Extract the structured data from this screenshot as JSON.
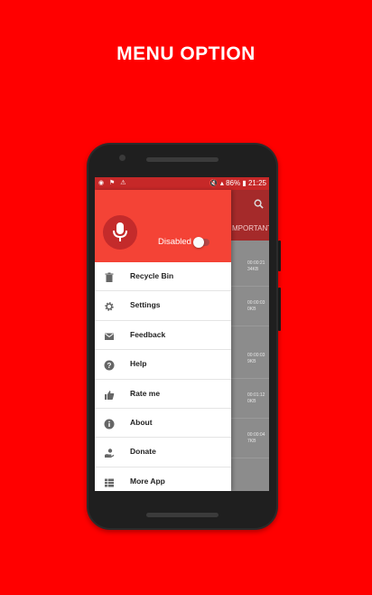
{
  "headline": "MENU OPTION",
  "status_bar": {
    "left_icons": "◉ ⚑ ⚠",
    "right_text": "🔇 ▴ 86% ▮ 21:25"
  },
  "background_app": {
    "tab_label": "MPORTANT",
    "rows": [
      {
        "time": "00:00:21",
        "size": "34KB"
      },
      {
        "time": "00:00:03",
        "size": "0KB"
      },
      {
        "time": "00:00:03",
        "size": "9KB"
      },
      {
        "time": "00:01:12",
        "size": "0KB"
      },
      {
        "time": "00:00:04",
        "size": "7KB"
      }
    ]
  },
  "drawer": {
    "toggle_label": "Disabled",
    "toggle_on": false,
    "accent_color": "#f44336",
    "items": [
      {
        "label": "Recycle Bin",
        "icon": "trash-icon"
      },
      {
        "label": "Settings",
        "icon": "gear-icon"
      },
      {
        "label": "Feedback",
        "icon": "mail-icon"
      },
      {
        "label": "Help",
        "icon": "help-icon"
      },
      {
        "label": "Rate me",
        "icon": "thumbs-up-icon"
      },
      {
        "label": "About",
        "icon": "info-icon"
      },
      {
        "label": "Donate",
        "icon": "donate-icon"
      },
      {
        "label": "More App",
        "icon": "apps-icon"
      }
    ]
  }
}
